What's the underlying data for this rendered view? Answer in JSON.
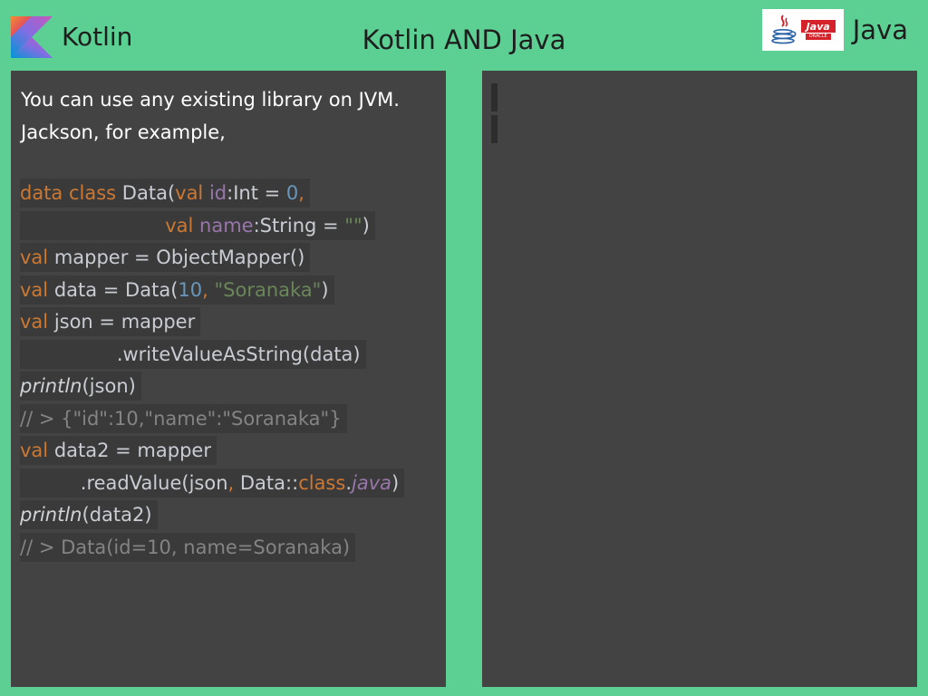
{
  "header": {
    "left_label": "Kotlin",
    "title": "Kotlin AND Java",
    "right_label": "Java",
    "java_logo_text": "Java",
    "java_logo_subtext": "ORACLE"
  },
  "left_panel": {
    "intro": [
      "You can use any existing library on JVM.",
      "Jackson, for example,"
    ],
    "code_lines": [
      [
        {
          "t": "data class ",
          "c": "kw"
        },
        {
          "t": "Data(",
          "c": "pl"
        },
        {
          "t": "val ",
          "c": "kw"
        },
        {
          "t": "id",
          "c": "pr"
        },
        {
          "t": ":Int = ",
          "c": "pl"
        },
        {
          "t": "0",
          "c": "nm"
        },
        {
          "t": ",",
          "c": "kw"
        }
      ],
      [
        {
          "t": "                        ",
          "c": "pl"
        },
        {
          "t": "val ",
          "c": "kw"
        },
        {
          "t": "name",
          "c": "pr"
        },
        {
          "t": ":String = ",
          "c": "pl"
        },
        {
          "t": "\"\"",
          "c": "st"
        },
        {
          "t": ")",
          "c": "pl"
        }
      ],
      [
        {
          "t": "val ",
          "c": "kw"
        },
        {
          "t": "mapper = ObjectMapper()",
          "c": "pl"
        }
      ],
      [
        {
          "t": "val ",
          "c": "kw"
        },
        {
          "t": "data = Data(",
          "c": "pl"
        },
        {
          "t": "10",
          "c": "nm"
        },
        {
          "t": ", ",
          "c": "kw"
        },
        {
          "t": "\"Soranaka\"",
          "c": "st"
        },
        {
          "t": ")",
          "c": "pl"
        }
      ],
      [
        {
          "t": "val ",
          "c": "kw"
        },
        {
          "t": "json = mapper",
          "c": "pl"
        }
      ],
      [
        {
          "t": "                ",
          "c": "pl"
        },
        {
          "t": ".writeValueAsString(data)",
          "c": "pl"
        }
      ],
      [
        {
          "t": "println",
          "c": "it"
        },
        {
          "t": "(json)",
          "c": "pl"
        }
      ],
      [
        {
          "t": "// > {\"id\":10,\"name\":\"Soranaka\"}",
          "c": "cm"
        }
      ],
      [
        {
          "t": "val ",
          "c": "kw"
        },
        {
          "t": "data2 = mapper",
          "c": "pl"
        }
      ],
      [
        {
          "t": "          ",
          "c": "pl"
        },
        {
          "t": ".readValue(json",
          "c": "pl"
        },
        {
          "t": ", ",
          "c": "kw"
        },
        {
          "t": "Data::",
          "c": "pl"
        },
        {
          "t": "class",
          "c": "kw"
        },
        {
          "t": ".",
          "c": "pl"
        },
        {
          "t": "java",
          "c": "ji"
        },
        {
          "t": ")",
          "c": "pl"
        }
      ],
      [
        {
          "t": "println",
          "c": "it"
        },
        {
          "t": "(data2)",
          "c": "pl"
        }
      ],
      [
        {
          "t": "// > Data(id=10, name=Soranaka)",
          "c": "cm"
        }
      ]
    ]
  },
  "colors": {
    "background": "#5ccf93",
    "panel": "#434343",
    "code_highlight": "#3a3a3a",
    "keyword": "#cc7833",
    "property": "#9876aa",
    "number": "#6897bb",
    "string": "#6a8759",
    "comment": "#848484"
  }
}
